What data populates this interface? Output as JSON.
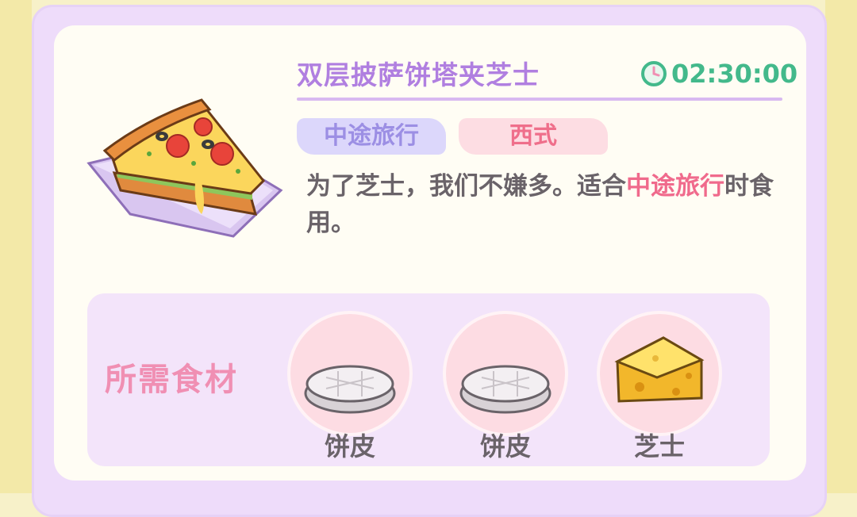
{
  "dish": {
    "name": "双层披萨饼塔夹芝士",
    "time": "02:30:00",
    "image_icon": "pizza-slice-icon",
    "tags": [
      "中途旅行",
      "西式"
    ],
    "description_before": "为了芝士，我们不嫌多。适合",
    "description_highlight": "中途旅行",
    "description_after": "时食用。"
  },
  "ingredients": {
    "title": "所需食材",
    "items": [
      {
        "label": "饼皮",
        "icon": "dough-crust-icon"
      },
      {
        "label": "饼皮",
        "icon": "dough-crust-icon"
      },
      {
        "label": "芝士",
        "icon": "cheese-icon"
      }
    ]
  },
  "colors": {
    "title": "#b07fe0",
    "timer": "#43b98b",
    "tag_purple_bg": "#dcd7fb",
    "tag_pink_bg": "#fddde3",
    "highlight": "#f06a8c",
    "ingredients_title": "#f08fb3"
  }
}
